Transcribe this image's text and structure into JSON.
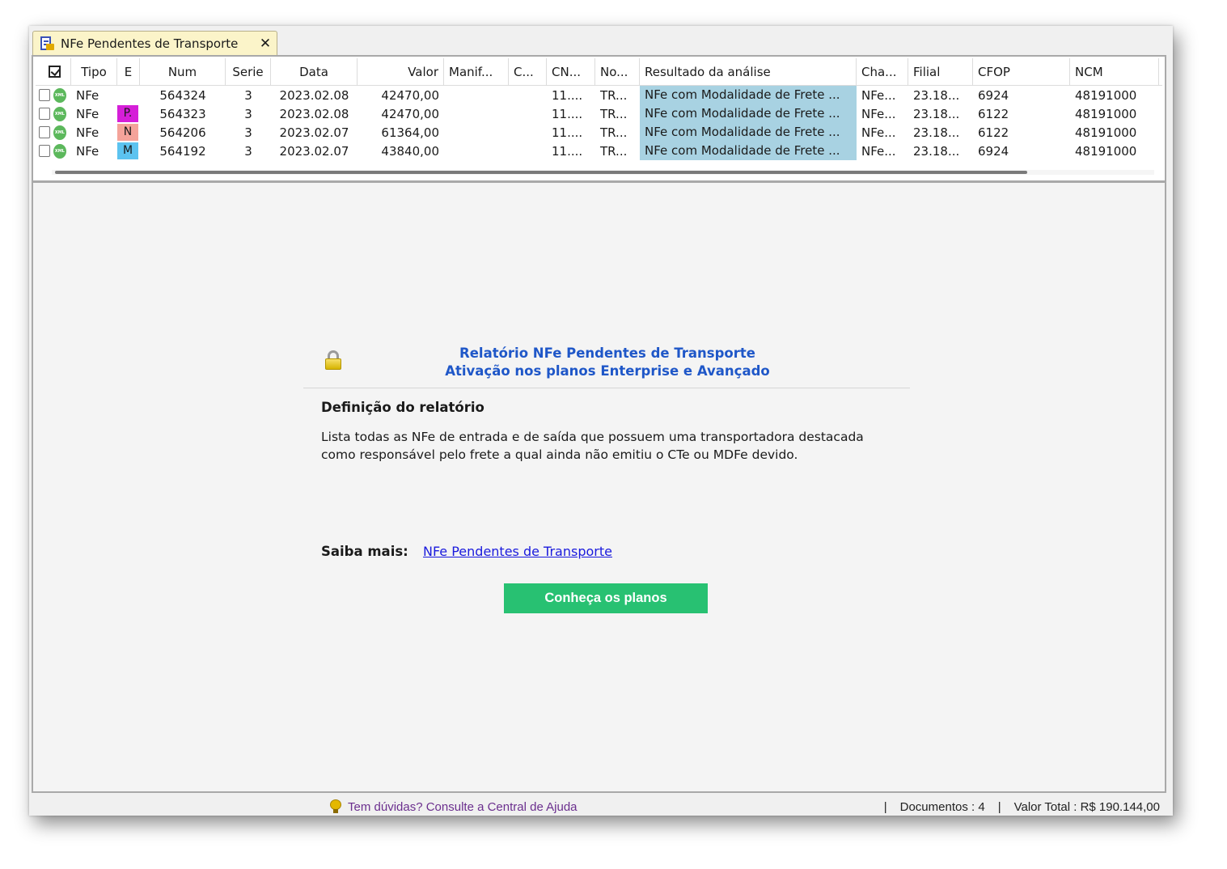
{
  "tab": {
    "title": "NFe Pendentes de Transporte",
    "close_glyph": "✕",
    "icon": "document-truck-icon"
  },
  "grid": {
    "columns": [
      "Tipo",
      "E",
      "Num",
      "Serie",
      "Data",
      "Valor",
      "Manif...",
      "C...",
      "CN...",
      "No...",
      "Resultado da análise",
      "Cha...",
      "Filial",
      "CFOP",
      "NCM"
    ],
    "xml_icon_text": "XML",
    "rows": [
      {
        "tipo": "NFe",
        "e": "",
        "e_color": "",
        "num": "564324",
        "serie": "3",
        "data": "2023.02.08",
        "valor": "42470,00",
        "manif": "",
        "c": "",
        "cn": "11....",
        "no": "TR...",
        "resultado": "NFe com Modalidade de Frete ...",
        "cha": "NFe...",
        "filial": "23.18...",
        "cfop": "6924",
        "ncm": "48191000"
      },
      {
        "tipo": "NFe",
        "e": "P.",
        "e_color": "#d51fd8",
        "num": "564323",
        "serie": "3",
        "data": "2023.02.08",
        "valor": "42470,00",
        "manif": "",
        "c": "",
        "cn": "11....",
        "no": "TR...",
        "resultado": "NFe com Modalidade de Frete ...",
        "cha": "NFe...",
        "filial": "23.18...",
        "cfop": "6122",
        "ncm": "48191000"
      },
      {
        "tipo": "NFe",
        "e": "N",
        "e_color": "#f4a39a",
        "num": "564206",
        "serie": "3",
        "data": "2023.02.07",
        "valor": "61364,00",
        "manif": "",
        "c": "",
        "cn": "11....",
        "no": "TR...",
        "resultado": "NFe com Modalidade de Frete ...",
        "cha": "NFe...",
        "filial": "23.18...",
        "cfop": "6122",
        "ncm": "48191000"
      },
      {
        "tipo": "NFe",
        "e": "M",
        "e_color": "#5cc3f0",
        "num": "564192",
        "serie": "3",
        "data": "2023.02.07",
        "valor": "43840,00",
        "manif": "",
        "c": "",
        "cn": "11....",
        "no": "TR...",
        "resultado": "NFe com Modalidade de Frete ...",
        "cha": "NFe...",
        "filial": "23.18...",
        "cfop": "6924",
        "ncm": "48191000"
      }
    ]
  },
  "promo": {
    "title_line1": "Relatório NFe Pendentes de Transporte",
    "title_line2": "Ativação nos planos Enterprise e Avançado",
    "def_title": "Definição do relatório",
    "def_line1": "Lista todas as NFe de entrada e de saída que possuem uma transportadora destacada",
    "def_line2": "como responsável pelo frete a qual ainda não emitiu o CTe ou MDFe devido.",
    "saiba_label": "Saiba mais:",
    "saiba_link": "NFe Pendentes de Transporte",
    "cta_label": "Conheça os planos",
    "cta_color": "#28c172",
    "title_color": "#1f57c8"
  },
  "status": {
    "help_text": "Tem dúvidas? Consulte a Central de Ajuda",
    "sep": "|",
    "documentos": "Documentos : 4",
    "valor_total": "Valor Total : R$ 190.144,00"
  }
}
